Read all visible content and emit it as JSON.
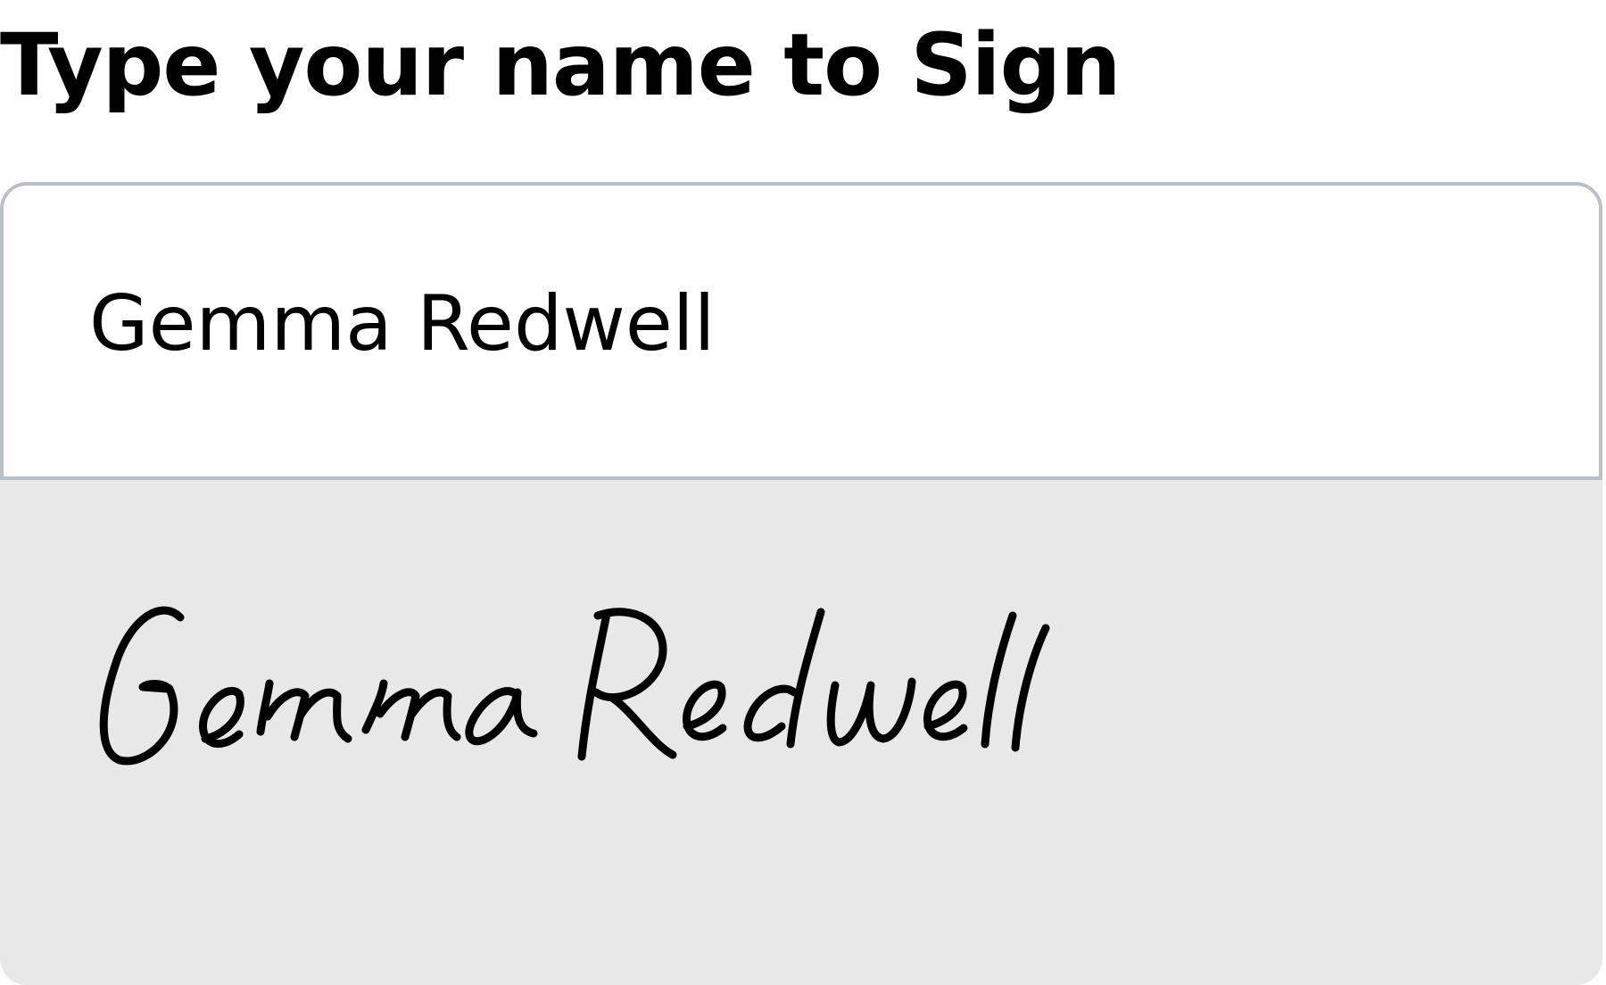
{
  "heading": "Type your name to Sign",
  "name_input": {
    "value": "Gemma Redwell",
    "placeholder": ""
  },
  "signature": {
    "text": "Gemma Redwell",
    "ink_color": "#000000"
  },
  "colors": {
    "field_border": "#b7c0cc",
    "signature_background": "#e8e8e8",
    "signature_line": "#a6a6a6"
  }
}
